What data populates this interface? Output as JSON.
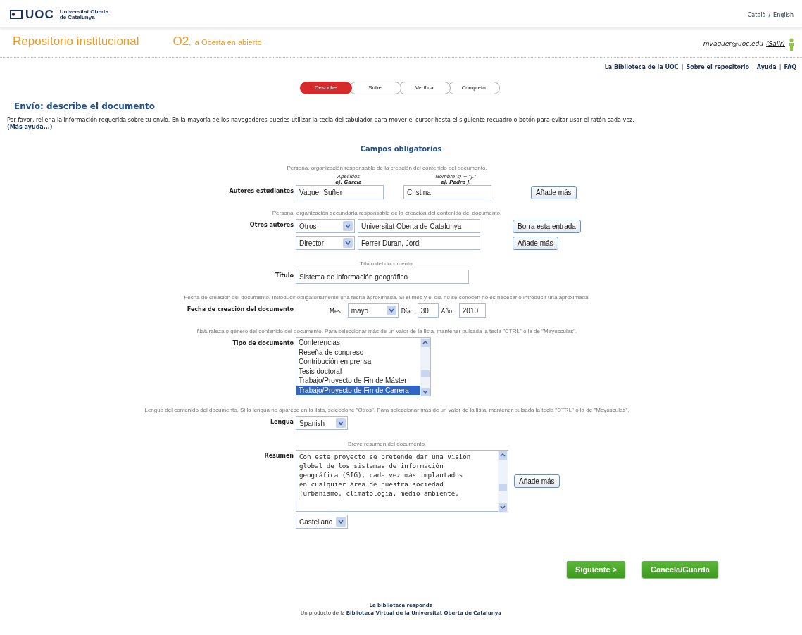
{
  "header": {
    "logo": "UOC",
    "institution_lines": [
      "Universitat Oberta",
      "de Catalunya"
    ],
    "languages": [
      {
        "label": "Català"
      },
      {
        "label": "English"
      }
    ],
    "language_separator": "/"
  },
  "banner": {
    "title": "Repositorio institucional",
    "brand": "O2",
    "tagline": ", la Oberta en abierto",
    "user": "mvaquer@uoc.edu",
    "logout": "(Salir)"
  },
  "top_links": [
    "La Biblioteca de la UOC",
    "Sobre el repositorio",
    "Ayuda",
    "FAQ"
  ],
  "top_link_separator": "|",
  "steps": [
    {
      "label": "Describe",
      "selected": true
    },
    {
      "label": "Sube",
      "selected": false
    },
    {
      "label": "Verifica",
      "selected": false
    },
    {
      "label": "Completo",
      "selected": false
    }
  ],
  "page_title": "Envío: describe el documento",
  "intro": "Por favor, rellena la información requerida sobre tu envío. En la mayoría de los navegadores puedes utilizar la tecla del tabulador para mover el cursor hasta el siguiente recuadro o botón para evitar usar el ratón cada vez.",
  "more_help": "(Más ayuda...)",
  "section_title": "Campos obligatorios",
  "fields": [
    {
      "kind": "authors",
      "hint": "Persona, organización responsable de la creación del contenido del documento.",
      "label": "Autores estudiantes",
      "columns": [
        {
          "title": "Apellidos",
          "example": "ej. García"
        },
        {
          "title": "Nombre(s) + \"J.\"",
          "example": "ej. Pedro J."
        }
      ],
      "values": [
        "Vaquer Suñer",
        "Cristina"
      ],
      "button": "Añade más"
    },
    {
      "kind": "other_authors",
      "hint": "Persona, organización secundaria responsable de la creación del contenido del documento.",
      "label": "Otros autores",
      "rows": [
        {
          "role": "Otros",
          "name": "Universitat Oberta de Catalunya",
          "button": "Borra esta entrada"
        },
        {
          "role": "Director",
          "name": "Ferrer Duran, Jordi",
          "button": "Añade más"
        }
      ]
    },
    {
      "kind": "text",
      "hint": "Título del documento.",
      "label": "Título",
      "value": "Sistema de información geográfico"
    },
    {
      "kind": "date",
      "hint": "Fecha de creación del documento. Introducir obligatoriamente una fecha aproximada. Si el mes y el día no se conocen no es necesario introducir una aproximada.",
      "label": "Fecha de creación del documento",
      "month_label": "Mes:",
      "month": "mayo",
      "day_label": "Día:",
      "day": "30",
      "year_label": "Año:",
      "year": "2010"
    },
    {
      "kind": "listbox",
      "hint": "Naturaleza o género del contenido del documento. Para seleccionar más de un valor de la lista, mantener pulsada la tecla \"CTRL\" o la de \"Mayúsculas\".",
      "label": "Tipo de documento",
      "options": [
        {
          "label": "Conferencias",
          "selected": false
        },
        {
          "label": "Reseña de congreso",
          "selected": false
        },
        {
          "label": "Contribución en prensa",
          "selected": false
        },
        {
          "label": "Tesis doctoral",
          "selected": false
        },
        {
          "label": "Trabajo/Proyecto de Fin de Máster",
          "selected": false
        },
        {
          "label": "Trabajo/Proyecto de Fin de Carrera",
          "selected": true
        }
      ]
    },
    {
      "kind": "select",
      "hint": "Lengua del contenido del documento. Si la lengua no aparece en la lista, seleccione \"Otros\". Para seleccionar más de un valor de la lista, mantener pulsada la tecla \"CTRL\" o la de \"Mayúsculas\".",
      "label": "Lengua",
      "value": "Spanish"
    },
    {
      "kind": "textarea",
      "hint": "Breve resumen del documento.",
      "label": "Resumen",
      "lines": [
        "Con este proyecto se pretende dar una visión",
        "global de los sistemas de información",
        "geográfica (SIG), cada vez más implantados",
        "en cualquier área de nuestra sociedad",
        "(urbanismo, climatología, medio ambiente,"
      ],
      "language": "Castellano",
      "button": "Añade más"
    }
  ],
  "buttons": [
    "Siguiente >",
    "Cancela/Guarda"
  ],
  "footer": {
    "title": "La biblioteca responde",
    "prefix": "Un producto de la ",
    "link": "Biblioteca Virtual de la Universitat Oberta de Catalunya"
  }
}
